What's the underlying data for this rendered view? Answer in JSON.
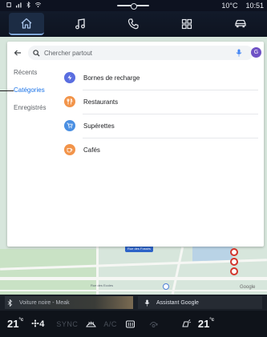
{
  "status_bar": {
    "temperature": "10°C",
    "time": "10:51"
  },
  "top_nav": {
    "items": [
      {
        "icon": "home-icon",
        "active": true
      },
      {
        "icon": "music-note-icon",
        "active": false
      },
      {
        "icon": "phone-icon",
        "active": false
      },
      {
        "icon": "apps-grid-icon",
        "active": false
      },
      {
        "icon": "car-icon",
        "active": false
      }
    ]
  },
  "search": {
    "placeholder": "Chercher partout",
    "avatar_letter": "G"
  },
  "side_tabs": [
    {
      "label": "Récents",
      "active": false
    },
    {
      "label": "Catégories",
      "active": true
    },
    {
      "label": "Enregistrés",
      "active": false
    }
  ],
  "categories": [
    {
      "label": "Bornes de recharge",
      "icon": "ev-charging-icon",
      "color": "#5a6ee0"
    },
    {
      "label": "Restaurants",
      "icon": "restaurant-icon",
      "color": "#f2944a"
    },
    {
      "label": "Supérettes",
      "icon": "shopping-cart-icon",
      "color": "#4a8fe2"
    },
    {
      "label": "Cafés",
      "icon": "coffee-icon",
      "color": "#f2944a"
    }
  ],
  "map": {
    "street_badge": "Rue des Fossés",
    "street_label": "Rue des Ecoles",
    "google_text": "Google"
  },
  "media": {
    "title": "Voiture noire - Meak"
  },
  "assistant": {
    "label": "Assistant Google"
  },
  "climate": {
    "left_temp": "21",
    "right_temp": "21",
    "temp_unit": "°c",
    "fan_level": "4",
    "sync_label": "SYNC",
    "ac_label": "A/C"
  }
}
